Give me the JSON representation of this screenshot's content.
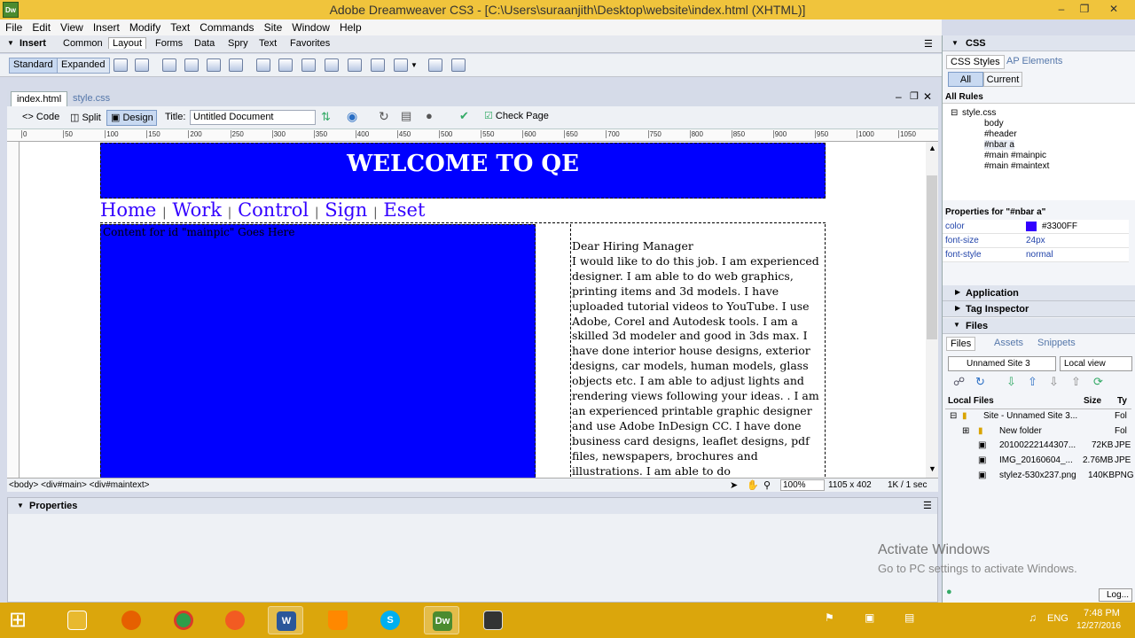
{
  "app": {
    "title": "Adobe Dreamweaver CS3 - [C:\\Users\\suraanjith\\Desktop\\website\\index.html (XHTML)]",
    "icon_label": "Dw"
  },
  "menu": [
    "File",
    "Edit",
    "View",
    "Insert",
    "Modify",
    "Text",
    "Commands",
    "Site",
    "Window",
    "Help"
  ],
  "insert": {
    "label": "Insert",
    "tabs": [
      "Common",
      "Layout",
      "Forms",
      "Data",
      "Spry",
      "Text",
      "Favorites"
    ],
    "active_tab": "Layout",
    "standard": "Standard",
    "expanded": "Expanded"
  },
  "doc": {
    "tabs": [
      "index.html",
      "style.css"
    ],
    "views": [
      "Code",
      "Split",
      "Design"
    ],
    "title_label": "Title:",
    "title_value": "Untitled Document",
    "check_page": "Check Page",
    "ruler": [
      "0",
      "50",
      "100",
      "150",
      "200",
      "250",
      "300",
      "350",
      "400",
      "450",
      "500",
      "550",
      "600",
      "650",
      "700",
      "750",
      "800",
      "850",
      "900",
      "950",
      "1000",
      "1050"
    ]
  },
  "page": {
    "header": "WELCOME TO QE",
    "nav": [
      "Home",
      "Work",
      "Control",
      "Sign",
      "Eset"
    ],
    "nav_separator": "|",
    "mainpic_text": "Content for id \"mainpic\" Goes Here",
    "maintext_heading": "Dear Hiring Manager",
    "maintext_body": "I would like to do this job. I am experienced designer. I am able to do web graphics, printing items and 3d models. I have uploaded tutorial videos to YouTube. I use Adobe, Corel and Autodesk tools. I am a skilled 3d modeler and good in 3ds max. I have done interior house designs, exterior designs, car models, human models, glass objects etc. I am able to adjust lights and rendering views following your ideas. . I am an experienced printable graphic designer and use Adobe InDesign CC. I have done business card designs, leaflet designs, pdf files, newspapers, brochures and illustrations. I am able to do"
  },
  "status": {
    "tags": "<body> <div#main> <div#maintext>",
    "zoom": "100%",
    "size": "1105 x 402",
    "speed": "1K / 1 sec"
  },
  "properties": {
    "title": "Properties"
  },
  "css": {
    "panel": "CSS",
    "tabs": [
      "CSS Styles",
      "AP Elements"
    ],
    "modes": [
      "All",
      "Current"
    ],
    "rules_label": "All Rules",
    "rules": [
      "style.css",
      "body",
      "#header",
      "#nbar a",
      "#main #mainpic",
      "#main #maintext"
    ],
    "props_title": "Properties for \"#nbar a\"",
    "props": [
      {
        "k": "color",
        "v": "#3300FF"
      },
      {
        "k": "font-size",
        "v": "24px"
      },
      {
        "k": "font-style",
        "v": "normal"
      }
    ]
  },
  "panels": {
    "application": "Application",
    "tag_inspector": "Tag Inspector",
    "files": "Files"
  },
  "files": {
    "tabs": [
      "Files",
      "Assets",
      "Snippets"
    ],
    "site": "Unnamed Site 3",
    "view": "Local view",
    "col_local": "Local Files",
    "col_size": "Size",
    "col_type": "Ty",
    "rows": [
      {
        "name": "Site - Unnamed Site 3...",
        "size": "",
        "type": "Fol"
      },
      {
        "name": "New folder",
        "size": "",
        "type": "Fol"
      },
      {
        "name": "20100222144307...",
        "size": "72KB",
        "type": "JPE"
      },
      {
        "name": "IMG_20160604_...",
        "size": "2.76MB",
        "type": "JPE"
      },
      {
        "name": "stylez-530x237.png",
        "size": "140KB",
        "type": "PNG"
      }
    ],
    "log": "Log..."
  },
  "watermark": {
    "line1": "Activate Windows",
    "line2": "Go to PC settings to activate Windows."
  },
  "taskbar": {
    "time": "7:48 PM",
    "date": "12/27/2016",
    "lang": "ENG"
  },
  "colors": {
    "blue": "#0000FF",
    "nav": "#3300FF",
    "titlebar": "#F0C43C",
    "taskbar": "#DBA60C"
  }
}
